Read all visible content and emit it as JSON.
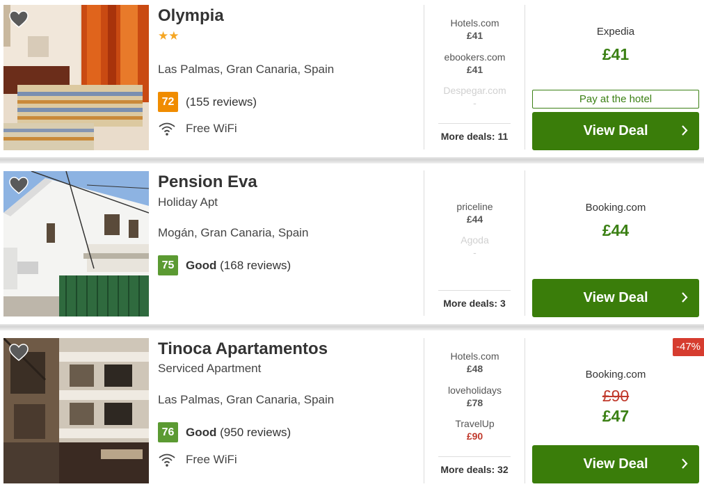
{
  "colors": {
    "accent_green": "#3a7d0a",
    "price_green": "#3b8014",
    "score_orange": "#f08c00",
    "score_green": "#5b9a32",
    "discount_red": "#d63c2f",
    "star_gold": "#f5a623"
  },
  "icons": {
    "favorite": "heart-icon",
    "wifi": "wifi-icon",
    "chevron": "chevron-right-icon"
  },
  "hotels": [
    {
      "name": "Olympia",
      "stars": "★★",
      "location": "Las Palmas, Gran Canaria, Spain",
      "score": "72",
      "rating_word": "",
      "reviews": "(155 reviews)",
      "amenity": "Free WiFi",
      "partners": [
        {
          "name": "Hotels.com",
          "price": "£41"
        },
        {
          "name": "ebookers.com",
          "price": "£41"
        },
        {
          "name": "Despegar.com",
          "price": "-"
        }
      ],
      "more_deals": "More deals: 11",
      "deal_provider": "Expedia",
      "deal_price": "£41",
      "pay_badge": "Pay at the hotel",
      "button": "View Deal"
    },
    {
      "name": "Pension Eva",
      "type": "Holiday Apt",
      "location": "Mogán, Gran Canaria, Spain",
      "score": "75",
      "rating_word": "Good",
      "reviews": "(168 reviews)",
      "partners": [
        {
          "name": "priceline",
          "price": "£44"
        },
        {
          "name": "Agoda",
          "price": "-"
        }
      ],
      "more_deals": "More deals: 3",
      "deal_provider": "Booking.com",
      "deal_price": "£44",
      "button": "View Deal"
    },
    {
      "name": "Tinoca Apartamentos",
      "type": "Serviced Apartment",
      "location": "Las Palmas, Gran Canaria, Spain",
      "score": "76",
      "rating_word": "Good",
      "reviews": "(950 reviews)",
      "amenity": "Free WiFi",
      "partners": [
        {
          "name": "Hotels.com",
          "price": "£48"
        },
        {
          "name": "loveholidays",
          "price": "£78"
        },
        {
          "name": "TravelUp",
          "price": "£90"
        }
      ],
      "more_deals": "More deals: 32",
      "discount": "-47%",
      "deal_provider": "Booking.com",
      "deal_old_price": "£90",
      "deal_price": "£47",
      "button": "View Deal"
    }
  ]
}
